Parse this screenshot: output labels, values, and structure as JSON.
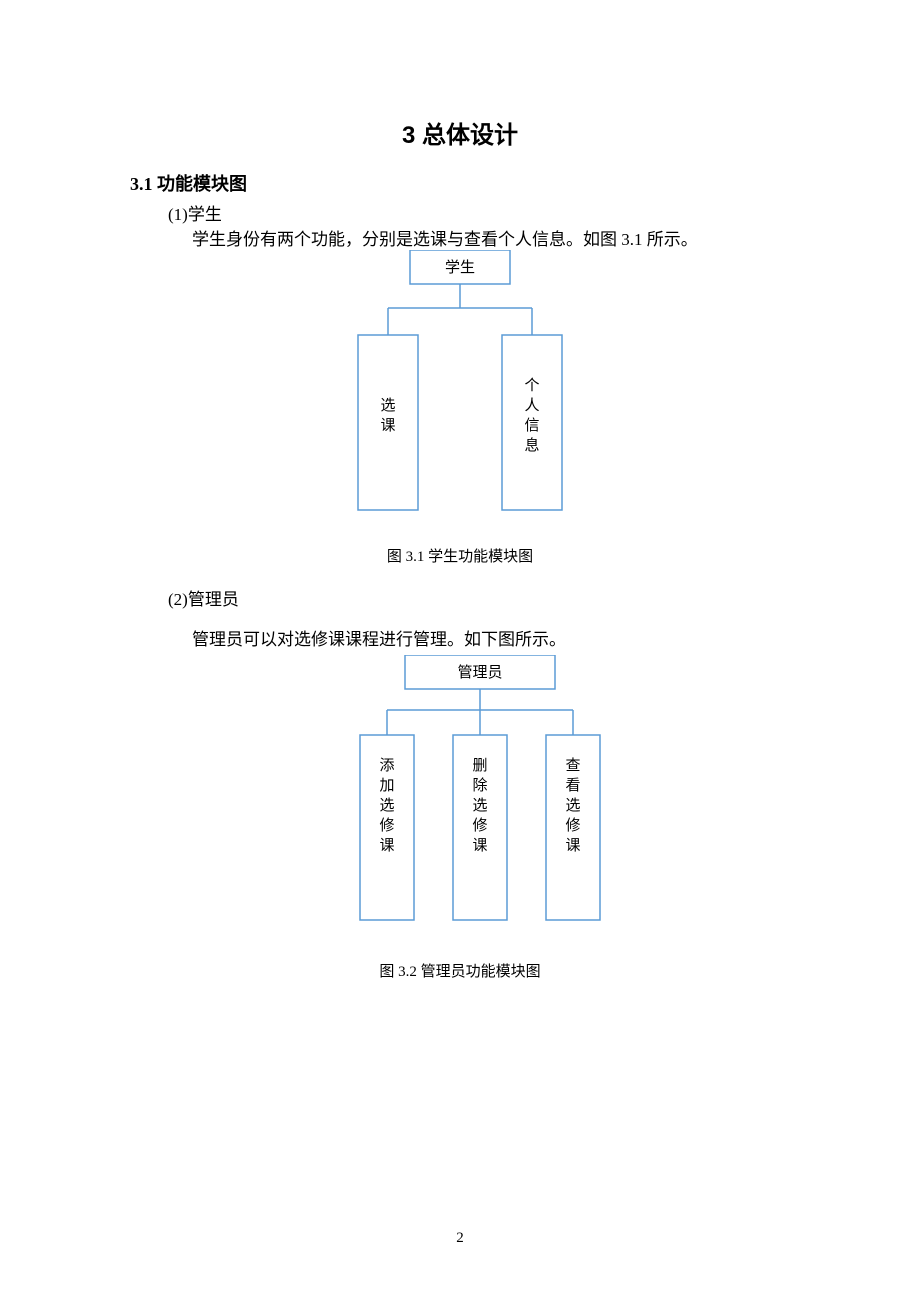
{
  "page": {
    "title": "3  总体设计",
    "section_heading": "3.1 功能模块图",
    "item1_label": "(1)学生",
    "item1_text": "学生身份有两个功能，分别是选课与查看个人信息。如图 3.1 所示。",
    "caption1": "图  3.1  学生功能模块图",
    "item2_label": "(2)管理员",
    "item2_text": "管理员可以对选修课课程进行管理。如下图所示。",
    "caption2": "图  3.2  管理员功能模块图",
    "page_number": "2"
  },
  "diagram1": {
    "root": "学生",
    "children": [
      "选课",
      "个人信息"
    ]
  },
  "diagram2": {
    "root": "管理员",
    "children": [
      "添加选修课",
      "删除选修课",
      "查看选修课"
    ]
  },
  "colors": {
    "box_border": "#5b9bd5",
    "connector": "#5b9bd5"
  }
}
